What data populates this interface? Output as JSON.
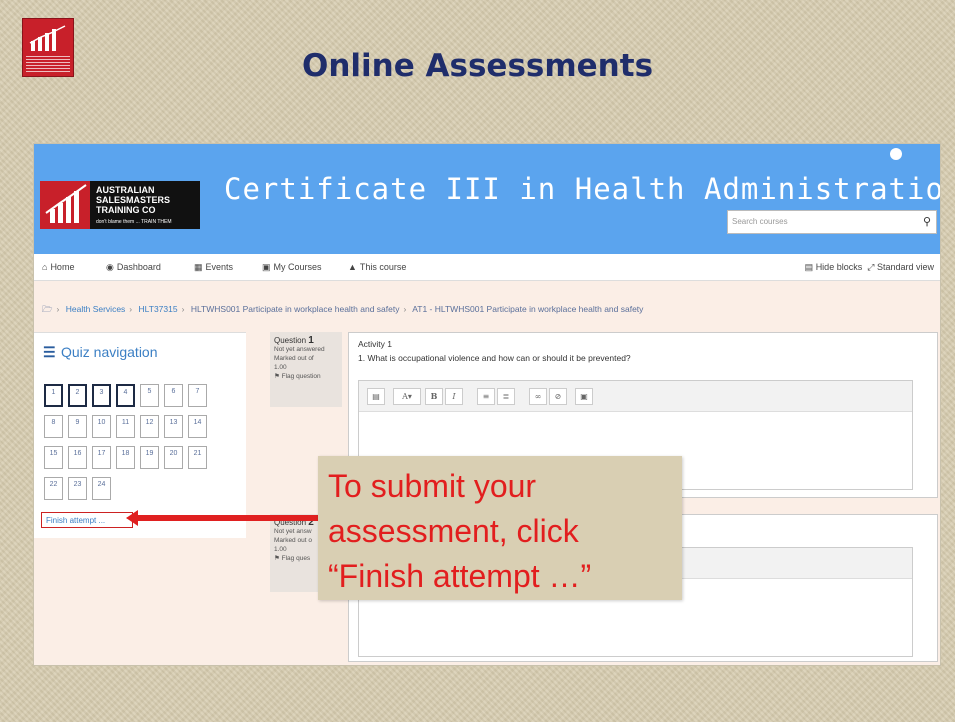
{
  "slide": {
    "title": "Online Assessments"
  },
  "site": {
    "brand_lines": [
      "AUSTRALIAN",
      "SALESMASTERS",
      "TRAINING CO"
    ],
    "brand_tagline": "don't blame them ... TRAIN THEM",
    "course_title": "Certificate III in Health Administration",
    "search_placeholder": "Search courses"
  },
  "navbar": {
    "items": [
      "Home",
      "Dashboard",
      "Events",
      "My Courses",
      "This course"
    ],
    "hide_blocks": "Hide blocks",
    "standard_view": "Standard view"
  },
  "breadcrumb": [
    "Health Services",
    "HLT37315",
    "HLTWHS001 Participate in workplace health and safety",
    "AT1 - HLTWHS001 Participate in workplace health and safety"
  ],
  "quiz_nav": {
    "title": "Quiz navigation",
    "questions": [
      "1",
      "2",
      "3",
      "4",
      "5",
      "6",
      "7",
      "8",
      "9",
      "10",
      "11",
      "12",
      "13",
      "14",
      "15",
      "16",
      "17",
      "18",
      "19",
      "20",
      "21",
      "22",
      "23",
      "24"
    ],
    "answered_count": 4,
    "finish_label": "Finish attempt ..."
  },
  "questions": [
    {
      "label": "Question",
      "number": "1",
      "status": "Not yet answered",
      "marked_out_of": "Marked out of",
      "marks": "1.00",
      "flag": "Flag question",
      "activity": "Activity 1",
      "text": "1. What is occupational violence and how can or should it be prevented?"
    },
    {
      "label": "Question",
      "number": "2",
      "status": "Not yet answ",
      "marked_out_of": "Marked out o",
      "marks": "1.00",
      "flag": "Flag ques",
      "text_tail": "nt"
    }
  ],
  "callout": {
    "lines": [
      "To submit your",
      "assessment, click",
      "“Finish attempt …”"
    ],
    "color": "#e21e1e"
  },
  "colors": {
    "banner": "#5ba4ee",
    "title": "#1f2d6b",
    "accent_red": "#e02020"
  }
}
